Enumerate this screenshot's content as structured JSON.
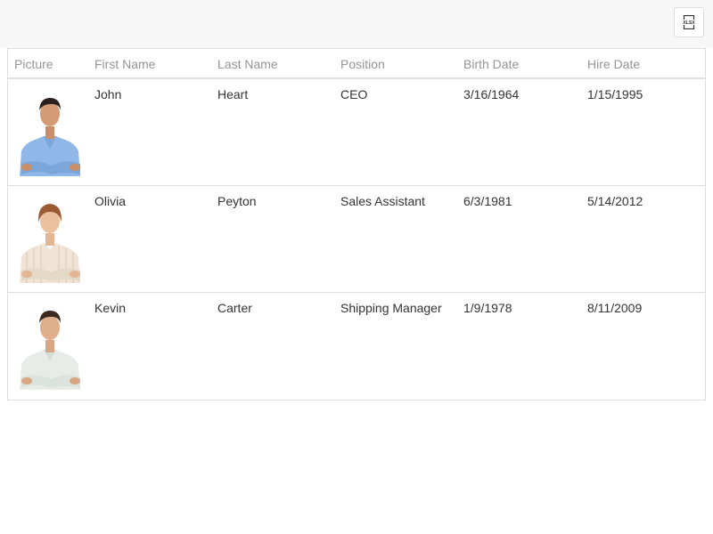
{
  "toolbar": {
    "export_icon": "xlsx-export-icon",
    "export_label": "XLSX"
  },
  "grid": {
    "columns": [
      "Picture",
      "First Name",
      "Last Name",
      "Position",
      "Birth Date",
      "Hire Date"
    ],
    "rows": [
      {
        "picture": "male-employee-photo-blue-shirt",
        "first_name": "John",
        "last_name": "Heart",
        "position": "CEO",
        "birth_date": "3/16/1964",
        "hire_date": "1/15/1995"
      },
      {
        "picture": "female-employee-photo-striped-shirt",
        "first_name": "Olivia",
        "last_name": "Peyton",
        "position": "Sales Assistant",
        "birth_date": "6/3/1981",
        "hire_date": "5/14/2012"
      },
      {
        "picture": "male-employee-photo-white-shirt",
        "first_name": "Kevin",
        "last_name": "Carter",
        "position": "Shipping Manager",
        "birth_date": "1/9/1978",
        "hire_date": "8/11/2009"
      }
    ]
  },
  "colors": {
    "header_text": "#959595",
    "cell_text": "#333333",
    "border": "#dddddd",
    "toolbar_bg": "#f7f7f7"
  }
}
